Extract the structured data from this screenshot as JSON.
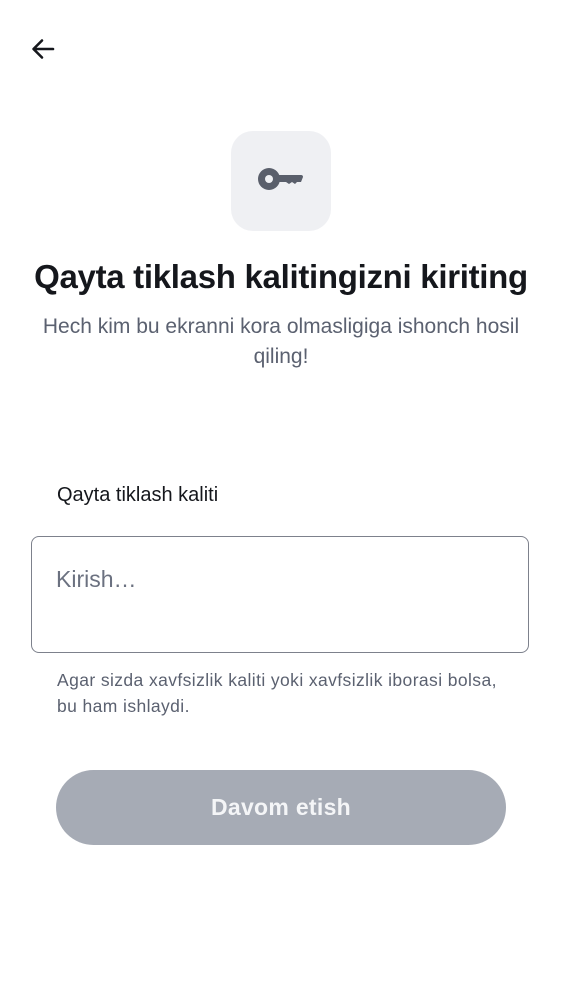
{
  "header": {
    "back_icon": "arrow-left-icon"
  },
  "hero": {
    "icon": "key-icon",
    "title": "Qayta tiklash kalitingizni kiriting",
    "subtitle": "Hech kim bu ekranni kora olmasligiga ishonch hosil qiling!"
  },
  "form": {
    "field_label": "Qayta tiklash kaliti",
    "input_placeholder": "Kirish…",
    "input_value": "",
    "helper_text": "Agar sizda xavfsizlik kaliti yoki xavfsizlik iborasi bolsa, bu ham ishlaydi.",
    "submit_label": "Davom etish",
    "submit_enabled": false
  },
  "colors": {
    "background": "#ffffff",
    "title_text": "#15171c",
    "secondary_text": "#5b6170",
    "icon_tile": "#eff0f3",
    "icon": "#5a5f6b",
    "input_border": "#7d818c",
    "button_disabled_bg": "#a6abb5",
    "button_disabled_text": "#f4f5f7"
  }
}
